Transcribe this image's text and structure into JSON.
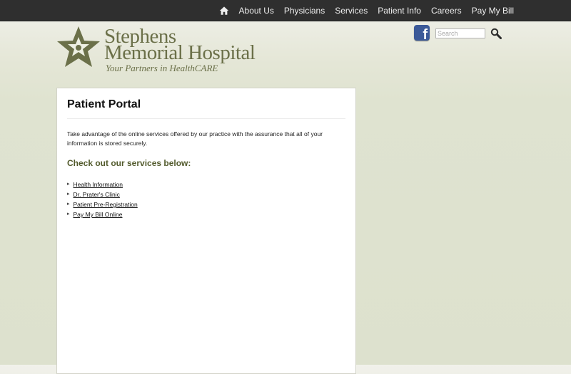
{
  "nav": {
    "home_icon": "home-icon",
    "items": [
      {
        "label": "About Us"
      },
      {
        "label": "Physicians"
      },
      {
        "label": "Services"
      },
      {
        "label": "Patient Info"
      },
      {
        "label": "Careers"
      },
      {
        "label": "Pay My Bill"
      }
    ]
  },
  "header": {
    "logo_icon": "hands-star-logo",
    "brand_line1": "Stephens",
    "brand_line2": "Memorial Hospital",
    "tagline": "Your Partners in HealthCARE",
    "facebook_icon": "facebook-icon",
    "search_placeholder": "Search",
    "search_icon": "magnifier-icon"
  },
  "colors": {
    "nav_bg": "#2f2f2f",
    "brand": "#6b7049",
    "subheading": "#525a2c",
    "facebook": "#3b5998"
  },
  "content": {
    "title": "Patient Portal",
    "intro": "Take advantage of the online services offered by our practice with the assurance that all of your information is stored securely.",
    "subtitle": "Check out our services below:",
    "services": [
      {
        "label": "Health Information "
      },
      {
        "label": "Dr. Prater's Clinic"
      },
      {
        "label": "Patient Pre-Registration"
      },
      {
        "label": "Pay My Bill Online"
      }
    ]
  }
}
